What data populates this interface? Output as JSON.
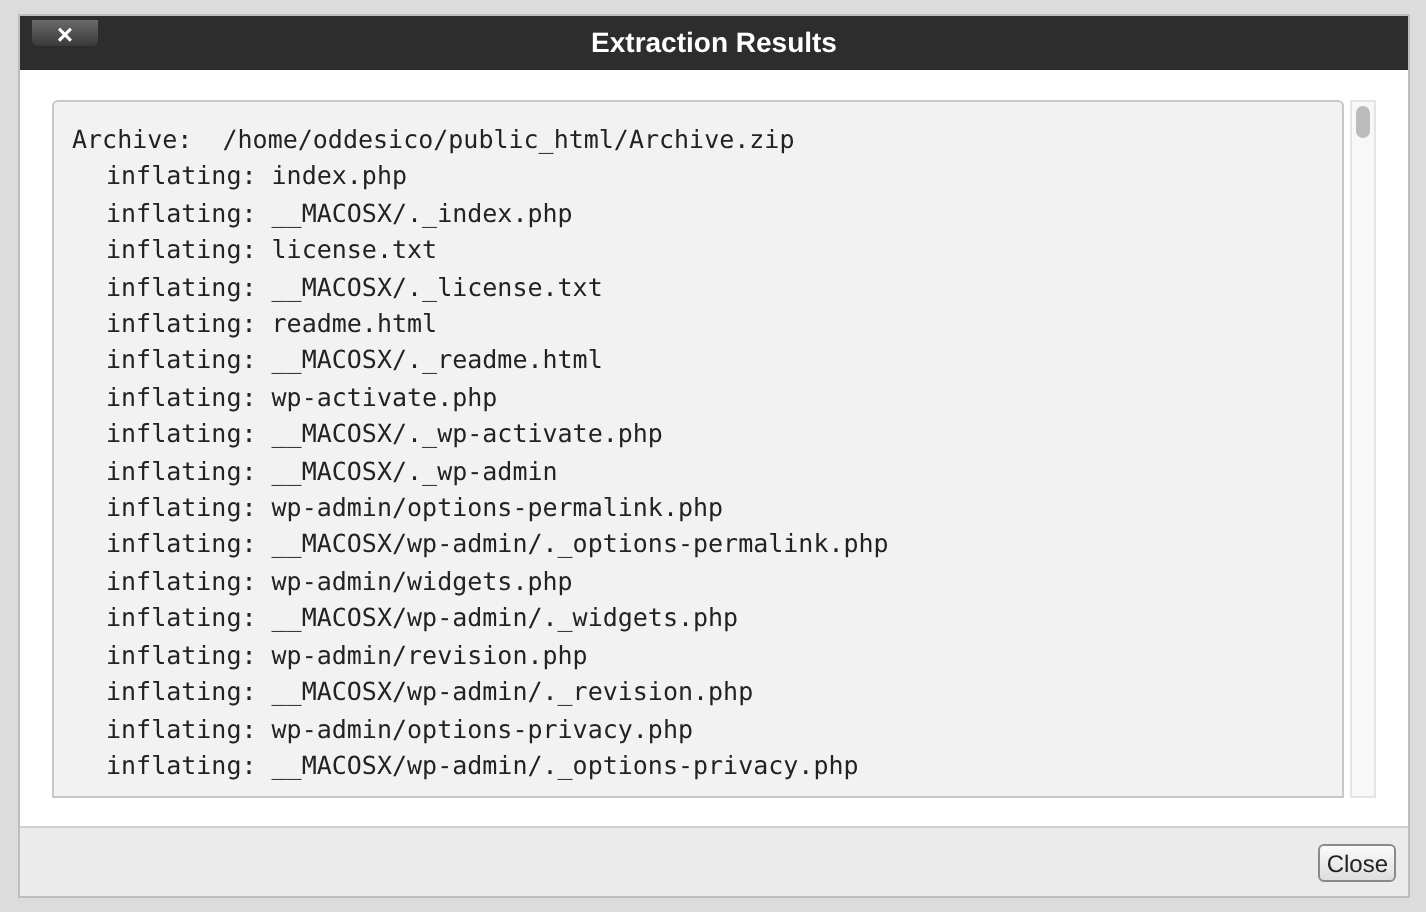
{
  "dialog": {
    "close_icon": "×",
    "title": "Extraction Results"
  },
  "log": {
    "header": "Archive:  /home/oddesico/public_html/Archive.zip",
    "lines": [
      "inflating: index.php",
      "inflating: __MACOSX/._index.php",
      "inflating: license.txt",
      "inflating: __MACOSX/._license.txt",
      "inflating: readme.html",
      "inflating: __MACOSX/._readme.html",
      "inflating: wp-activate.php",
      "inflating: __MACOSX/._wp-activate.php",
      "inflating: __MACOSX/._wp-admin",
      "inflating: wp-admin/options-permalink.php",
      "inflating: __MACOSX/wp-admin/._options-permalink.php",
      "inflating: wp-admin/widgets.php",
      "inflating: __MACOSX/wp-admin/._widgets.php",
      "inflating: wp-admin/revision.php",
      "inflating: __MACOSX/wp-admin/._revision.php",
      "inflating: wp-admin/options-privacy.php",
      "inflating: __MACOSX/wp-admin/._options-privacy.php"
    ]
  },
  "footer": {
    "button": "Close"
  }
}
